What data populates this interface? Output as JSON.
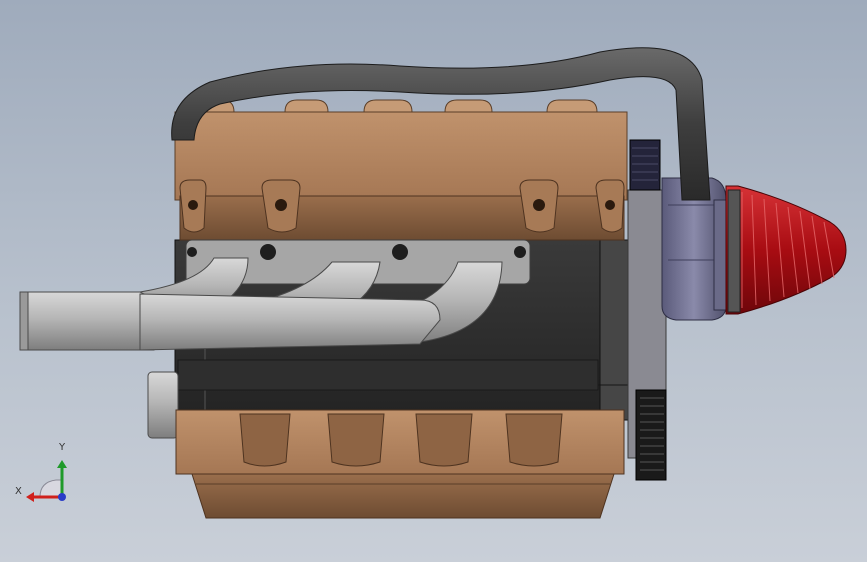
{
  "viewport": {
    "background_top": "#9fabbc",
    "background_bottom": "#c9cfd8"
  },
  "model": {
    "colors": {
      "bronze": "#b68863",
      "bronze_dark": "#7e5a3c",
      "block_dark": "#2c2c2c",
      "hose": "#4b4b4b",
      "manifold": "#b4b4b4",
      "filter_red": "#b01218",
      "pulley": "#6c6c8c",
      "belt": "#1a1a1a"
    }
  },
  "triad": {
    "x_label": "X",
    "y_label": "Y",
    "x_color": "#d0201c",
    "y_color": "#1f9a2a",
    "z_color": "#2a3cc8",
    "icon": "coordinate-triad-icon"
  }
}
